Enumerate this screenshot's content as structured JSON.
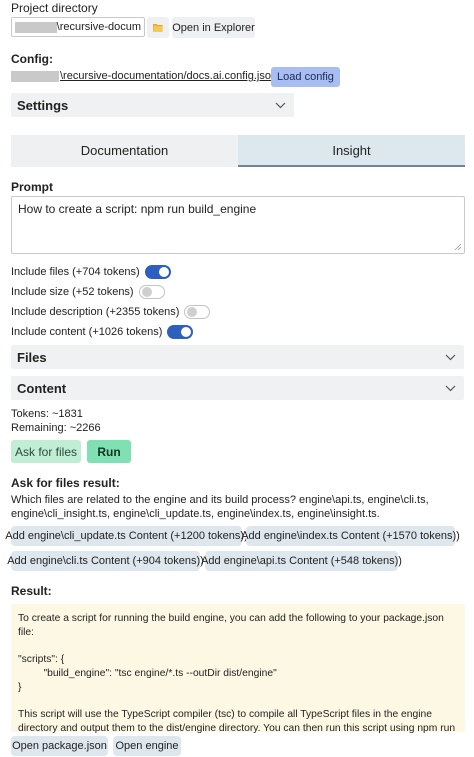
{
  "project": {
    "label": "Project directory",
    "dir_value": "\\recursive-docum",
    "explorer_button": "Open in Explorer",
    "folder_icon": "folder-icon"
  },
  "config": {
    "label": "Config:",
    "path": "\\recursive-documentation/docs.ai.config.json",
    "clear_glyph": "×",
    "load_button": "Load config"
  },
  "settings": {
    "title": "Settings"
  },
  "tabs": [
    {
      "label": "Documentation",
      "active": false
    },
    {
      "label": "Insight",
      "active": true
    }
  ],
  "prompt": {
    "label": "Prompt",
    "value": "How to create a script: npm run build_engine"
  },
  "toggles": [
    {
      "label": "Include files (+704 tokens)",
      "on": true
    },
    {
      "label": "Include size (+52 tokens)",
      "on": false
    },
    {
      "label": "Include description (+2355 tokens)",
      "on": false
    },
    {
      "label": "Include content (+1026 tokens)",
      "on": true
    }
  ],
  "sections": {
    "files": "Files",
    "content": "Content"
  },
  "tokens": {
    "total": "Tokens: ~1831",
    "remaining": "Remaining: ~2266"
  },
  "actions": {
    "ask": "Ask for files",
    "run": "Run"
  },
  "ask_result": {
    "label": "Ask for files result:",
    "text": "Which files are related to the engine and its build process? engine\\api.ts, engine\\cli.ts, engine\\cli_insight.ts, engine\\cli_update.ts, engine\\index.ts, engine\\insight.ts.",
    "buttons": [
      "Add engine\\cli_update.ts Content (+1200 tokens))",
      "Add engine\\index.ts Content (+1570 tokens))",
      "Add engine\\cli.ts Content (+904 tokens))",
      "Add engine\\api.ts Content (+548 tokens))"
    ]
  },
  "result": {
    "label": "Result:",
    "line1": "To create a script for running the build engine, you can add the following to your package.json file:",
    "code1": "\"scripts\": {",
    "code2": "    \"build_engine\": \"tsc engine/*.ts --outDir dist/engine\"",
    "code3": "}",
    "line2": "This script will use the TypeScript compiler (tsc) to compile all TypeScript files in the engine directory and output them to the dist/engine directory. You can then run this script using npm run build_engine."
  },
  "footer_buttons": {
    "open_package": "Open package.json",
    "open_engine": "Open engine"
  },
  "colors": {
    "accent_blue": "#2d5fbf",
    "run_green": "#7fe0b1",
    "ask_green": "#bfeed5",
    "result_bg": "#fdf8e4",
    "load_button": "#a8bdf2"
  }
}
